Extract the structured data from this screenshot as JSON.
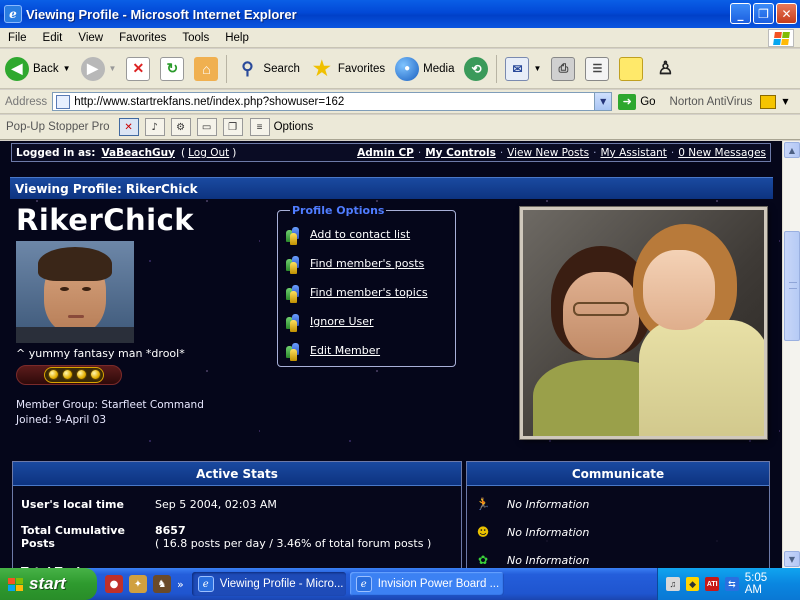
{
  "window": {
    "title": "Viewing Profile - Microsoft Internet Explorer",
    "buttons": {
      "minimize": "_",
      "maximize": "❐",
      "close": "✕"
    }
  },
  "menu": [
    "File",
    "Edit",
    "View",
    "Favorites",
    "Tools",
    "Help"
  ],
  "toolbar": {
    "back": "Back",
    "search": "Search",
    "favorites": "Favorites",
    "media": "Media"
  },
  "address": {
    "label": "Address",
    "url": "http://www.startrekfans.net/index.php?showuser=162",
    "go": "Go",
    "norton": "Norton AntiVirus"
  },
  "popup_bar": {
    "label": "Pop-Up Stopper Pro",
    "options": "Options"
  },
  "userbar": {
    "logged_in_label": "Logged in as:",
    "username": "VaBeachGuy",
    "logout_open": "(",
    "logout": "Log Out",
    "logout_close": ")",
    "links": [
      "Admin CP",
      "My Controls",
      "View New Posts",
      "My Assistant",
      "0 New Messages"
    ],
    "separator": "·"
  },
  "profile": {
    "heading": "Viewing Profile: RikerChick",
    "name": "RikerChick",
    "tagline": "^ yummy fantasy man *drool*",
    "member_group": "Member Group: Starfleet Command",
    "joined": "Joined: 9-April 03",
    "rank_pips": 4
  },
  "profile_options": {
    "title": "Profile Options",
    "items": [
      "Add to contact list",
      "Find member's posts",
      "Find member's topics",
      "Ignore User",
      "Edit Member"
    ]
  },
  "active_stats": {
    "title": "Active Stats",
    "rows": [
      {
        "key": "User's local time",
        "value": "Sep 5 2004, 02:03 AM"
      },
      {
        "key": "Total Cumulative Posts",
        "value": "8657",
        "sub": "( 16.8 posts per day / 3.46% of total forum posts )"
      },
      {
        "key": "Total Topics",
        "value": ""
      }
    ]
  },
  "communicate": {
    "title": "Communicate",
    "rows": [
      "No Information",
      "No Information",
      "No Information"
    ]
  },
  "taskbar": {
    "start": "start",
    "tasks": [
      "Viewing Profile - Micro...",
      "Invision Power Board ..."
    ],
    "chevron": "»",
    "clock": "5:05 AM"
  },
  "colors": {
    "xp_blue": "#0a5fe6",
    "forum_header": "#1a4aa0",
    "space_bg": "#05061a",
    "profile_options_title": "#4f7cff"
  }
}
